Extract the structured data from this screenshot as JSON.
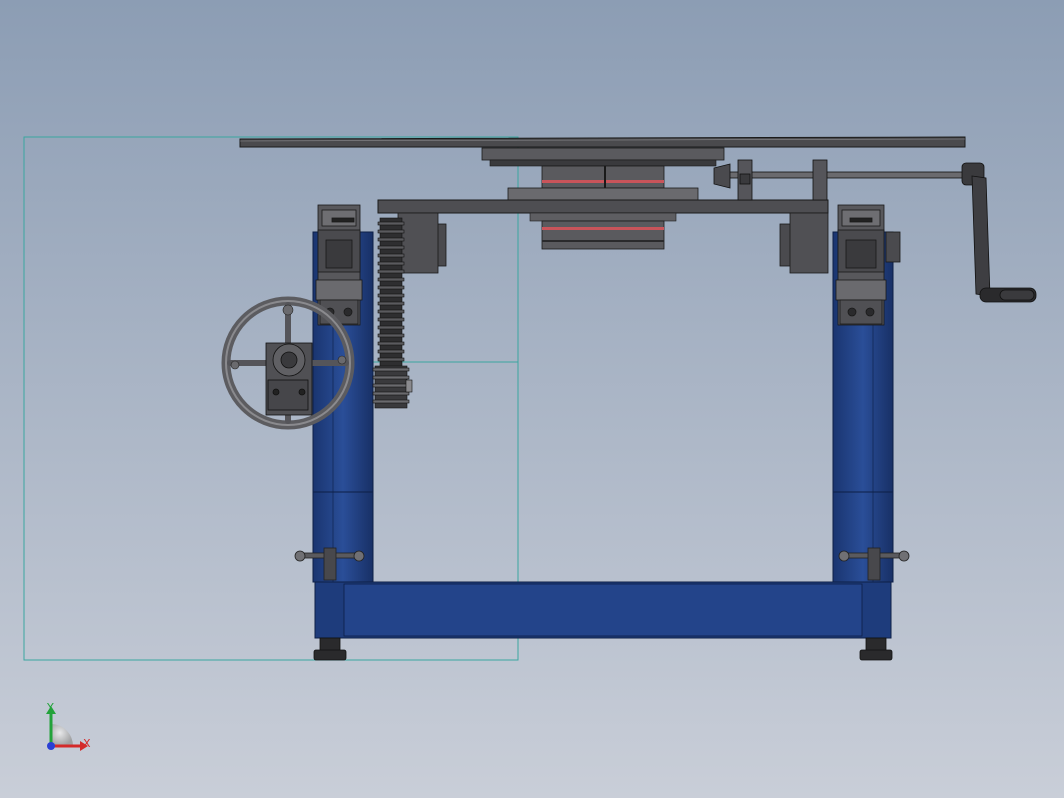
{
  "viewport": {
    "background_top": "#8c9db4",
    "background_bottom": "#c9ced8"
  },
  "colors": {
    "frame_blue": "#1c3a78",
    "frame_blue_light": "#2f56a5",
    "frame_edge": "#0d1f46",
    "steel_dark": "#3e3e40",
    "steel_mid": "#5d5d60",
    "steel_light": "#8a8a8e",
    "bearing_red": "#c9545a",
    "sketch_cyan": "#3aa6a0",
    "axis_x": "#d42a2a",
    "axis_y": "#23a23a",
    "axis_z": "#2a3fd4"
  },
  "triad": {
    "x_label": "X",
    "y_label": "Y"
  }
}
